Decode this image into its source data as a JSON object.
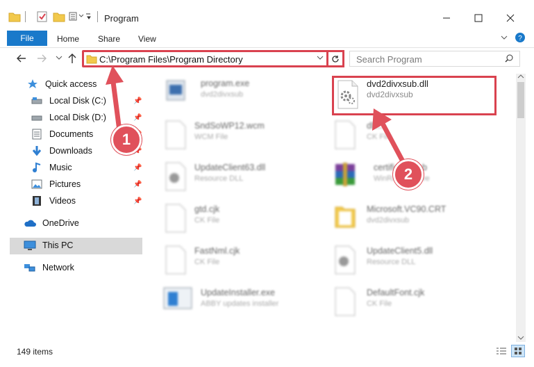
{
  "window": {
    "title": "Program"
  },
  "ribbon": {
    "tabs": [
      "File",
      "Home",
      "Share",
      "View"
    ]
  },
  "address": {
    "path": "C:\\Program Files\\Program Directory"
  },
  "search": {
    "placeholder": "Search Program"
  },
  "nav": {
    "items": [
      {
        "label": "Quick access",
        "icon": "star-icon",
        "pinned": false
      },
      {
        "label": "Local Disk (C:)",
        "icon": "drive-icon",
        "pinned": true
      },
      {
        "label": "Local Disk (D:)",
        "icon": "drive-icon",
        "pinned": true
      },
      {
        "label": "Documents",
        "icon": "documents-icon",
        "pinned": true
      },
      {
        "label": "Downloads",
        "icon": "download-icon",
        "pinned": true
      },
      {
        "label": "Music",
        "icon": "music-icon",
        "pinned": true
      },
      {
        "label": "Pictures",
        "icon": "pictures-icon",
        "pinned": true
      },
      {
        "label": "Videos",
        "icon": "videos-icon",
        "pinned": true
      },
      {
        "label": "OneDrive",
        "icon": "cloud-icon",
        "pinned": false
      },
      {
        "label": "This PC",
        "icon": "computer-icon",
        "pinned": false,
        "selected": true
      },
      {
        "label": "Network",
        "icon": "network-icon",
        "pinned": false
      }
    ]
  },
  "files": [
    {
      "name": "program.exe",
      "sub": "dvd2divxsub",
      "icon": "exe-icon"
    },
    {
      "name": "dvd2divxsub.dll",
      "sub": "dvd2divxsub",
      "icon": "dll-gear-icon",
      "highlighted": true
    },
    {
      "name": "SndSoWP12.wcm",
      "sub": "WCM File",
      "icon": "blank-file-icon"
    },
    {
      "name": "dll...",
      "sub": "CK File",
      "icon": "blank-file-icon"
    },
    {
      "name": "UpdateClient63.dll",
      "sub": "Resource DLL",
      "icon": "dll-gear-icon"
    },
    {
      "name": "certificate.cab",
      "sub": "WinRAR archive",
      "icon": "archive-icon"
    },
    {
      "name": "gtd.cjk",
      "sub": "CK File",
      "icon": "blank-file-icon"
    },
    {
      "name": "Microsoft.VC90.CRT",
      "sub": "dvd2divxsub",
      "icon": "folder-icon"
    },
    {
      "name": "FastNml.cjk",
      "sub": "CK File",
      "icon": "blank-file-icon"
    },
    {
      "name": "UpdateClient5.dll",
      "sub": "Resource DLL",
      "icon": "dll-gear-icon"
    },
    {
      "name": "UpdateInstaller.exe",
      "sub": "ABBY updates installer",
      "icon": "installer-icon"
    },
    {
      "name": "DefaultFont.cjk",
      "sub": "CK File",
      "icon": "blank-file-icon"
    }
  ],
  "status": {
    "count": "149 items"
  },
  "callouts": [
    {
      "number": "1"
    },
    {
      "number": "2"
    }
  ],
  "colors": {
    "accent": "#1979ca",
    "highlight": "#d9424f",
    "arrow": "#e0515b"
  }
}
